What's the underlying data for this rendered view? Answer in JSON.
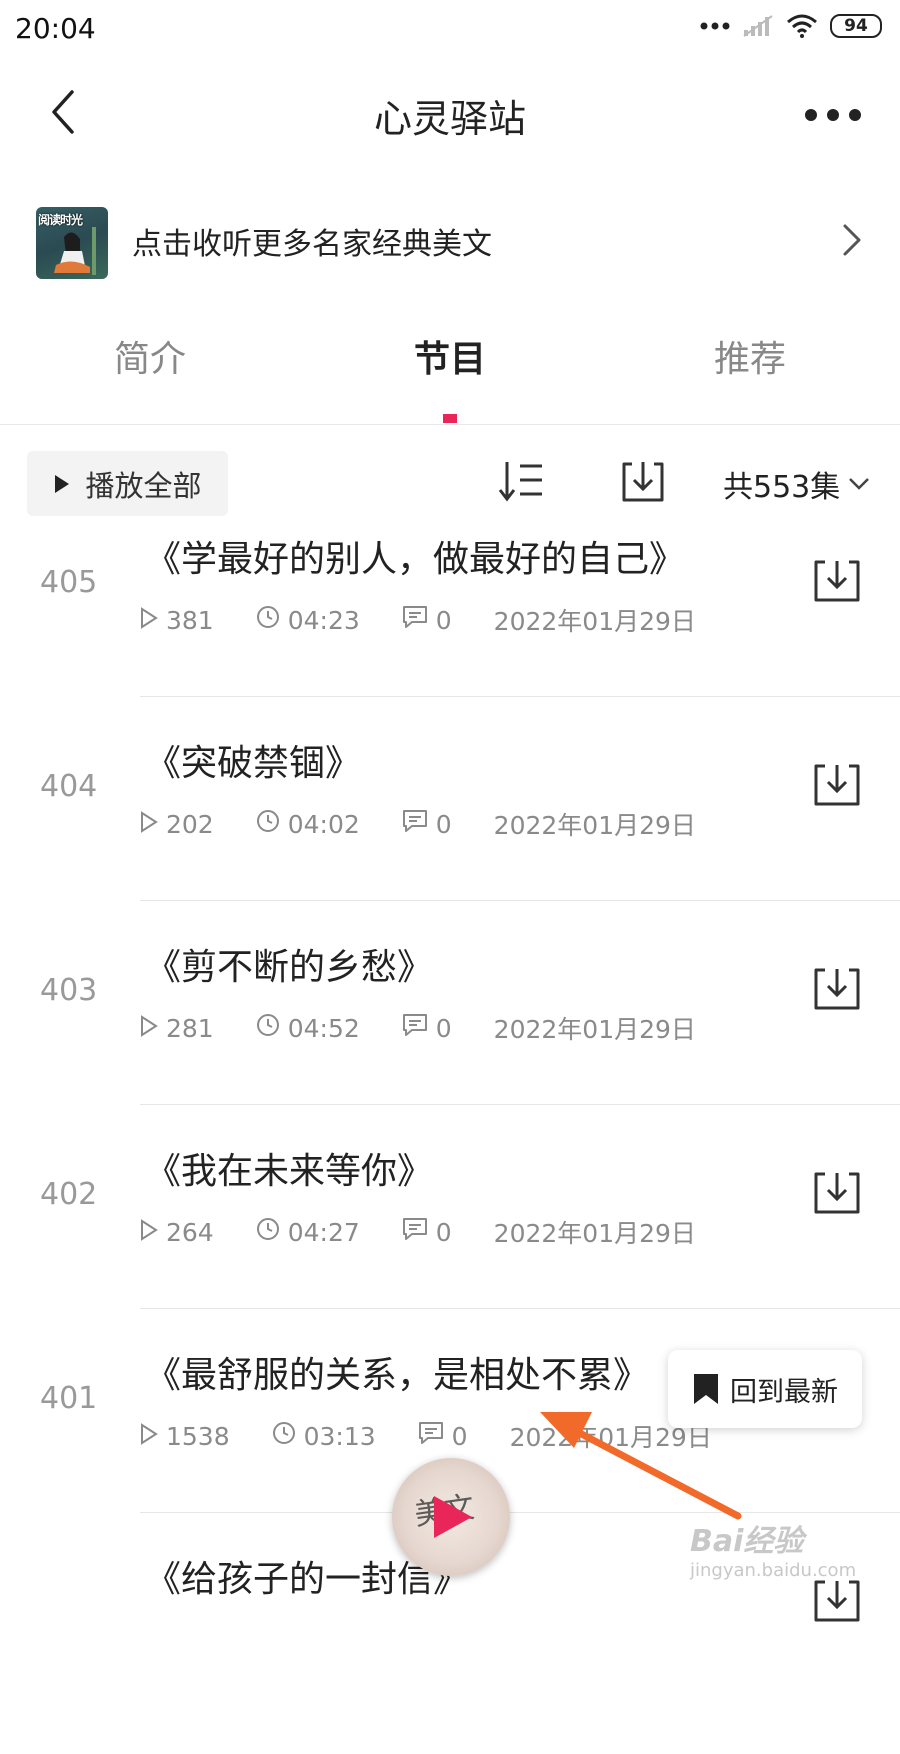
{
  "status_bar": {
    "time": "20:04",
    "battery": "94"
  },
  "header": {
    "title": "心灵驿站"
  },
  "banner": {
    "thumb_label": "阅读时光",
    "text": "点击收听更多名家经典美文"
  },
  "tabs": [
    {
      "label": "简介",
      "active": false
    },
    {
      "label": "节目",
      "active": true
    },
    {
      "label": "推荐",
      "active": false
    }
  ],
  "toolbar": {
    "play_all": "播放全部",
    "count": "共553集"
  },
  "episodes": [
    {
      "num": "405",
      "title": "《学最好的别人，做最好的自己》",
      "plays": "381",
      "duration": "04:23",
      "comments": "0",
      "date": "2022年01月29日"
    },
    {
      "num": "404",
      "title": "《突破禁锢》",
      "plays": "202",
      "duration": "04:02",
      "comments": "0",
      "date": "2022年01月29日"
    },
    {
      "num": "403",
      "title": "《剪不断的乡愁》",
      "plays": "281",
      "duration": "04:52",
      "comments": "0",
      "date": "2022年01月29日"
    },
    {
      "num": "402",
      "title": "《我在未来等你》",
      "plays": "264",
      "duration": "04:27",
      "comments": "0",
      "date": "2022年01月29日"
    },
    {
      "num": "401",
      "title": "《最舒服的关系，是相处不累》",
      "plays": "1538",
      "duration": "03:13",
      "comments": "0",
      "date": "2022年01月29日"
    },
    {
      "num": "",
      "title": "《给孩子的一封信》",
      "plays": "",
      "duration": "",
      "comments": "",
      "date": ""
    }
  ],
  "floating": {
    "back_to_latest": "回到最新",
    "mini_cover_text": "美文"
  },
  "watermark": {
    "main": "Bai经验",
    "sub": "jingyan.baidu.com"
  },
  "colors": {
    "accent": "#e8265a",
    "annotation_arrow": "#f26a2a",
    "muted": "#8a8a8a"
  },
  "icons": [
    "back-arrow-icon",
    "more-dots-icon",
    "chevron-right-icon",
    "play-icon",
    "sort-icon",
    "download-icon",
    "chevron-down-icon",
    "clock-icon",
    "comment-icon",
    "bookmark-icon"
  ]
}
